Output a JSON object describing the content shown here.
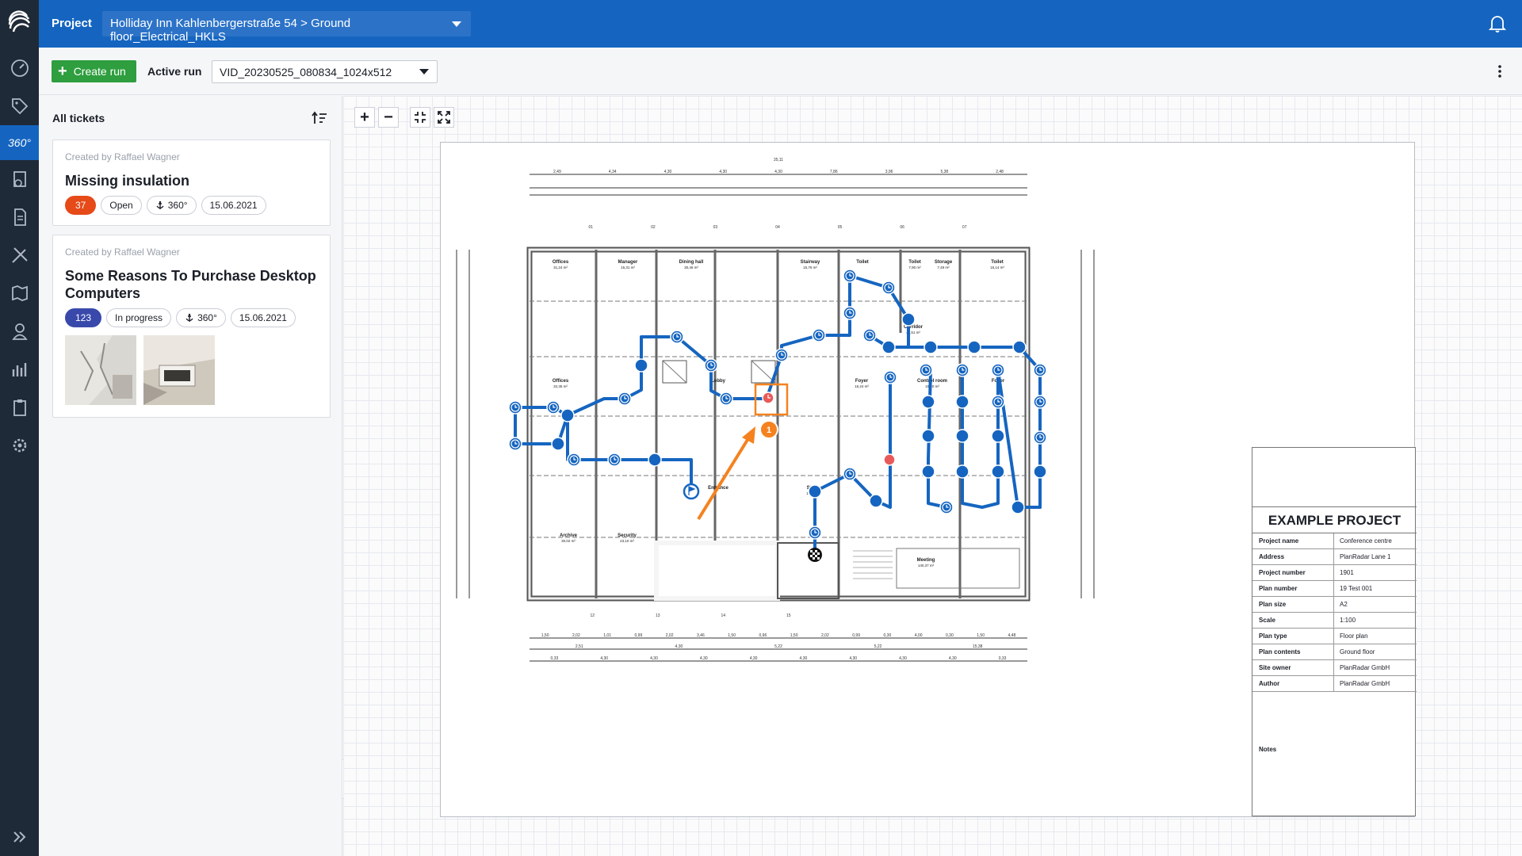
{
  "header": {
    "project_label": "Project",
    "project_path": "Holliday Inn Kahlenbergerstraße 54 > Ground floor_Electrical_HKLS"
  },
  "toolbar": {
    "create_run": "Create run",
    "active_run_label": "Active run",
    "active_run_value": "VID_20230525_080834_1024x512"
  },
  "nav": {
    "active_item": "360°"
  },
  "sidebar": {
    "heading": "All tickets",
    "tickets": [
      {
        "creator": "Created by Raffael Wagner",
        "title": "Missing insulation",
        "number": "37",
        "status": "Open",
        "type": "360°",
        "date": "15.06.2021"
      },
      {
        "creator": "Created by Raffael Wagner",
        "title": "Some Reasons To Purchase Desktop Computers",
        "number": "123",
        "status": "In progress",
        "type": "360°",
        "date": "15.06.2021"
      }
    ]
  },
  "plan": {
    "marker_number": "1",
    "rooms": [
      {
        "name": "Offices",
        "area": "31,24 m²"
      },
      {
        "name": "Manager",
        "area": "15,31 m²"
      },
      {
        "name": "Dining hall",
        "area": "30,46 m²"
      },
      {
        "name": "Stairway",
        "area": "15,76 m²"
      },
      {
        "name": "Toilet",
        "area": ""
      },
      {
        "name": "Toilet",
        "area": "7,90 m²"
      },
      {
        "name": "Storage",
        "area": "7,49 m²"
      },
      {
        "name": "Toilet",
        "area": "15,14 m²"
      },
      {
        "name": "Corridor",
        "area": "47,51 m²"
      },
      {
        "name": "Offices",
        "area": "32,35 m²"
      },
      {
        "name": "Lobby",
        "area": ""
      },
      {
        "name": "Foyer",
        "area": "16,24 m²"
      },
      {
        "name": "Control room",
        "area": "16,50 m²"
      },
      {
        "name": "Foyer",
        "area": ""
      },
      {
        "name": "Entrance",
        "area": ""
      },
      {
        "name": "Stairs",
        "area": "15,04 m²"
      },
      {
        "name": "Archive",
        "area": "30,02 m²"
      },
      {
        "name": "Security",
        "area": "23,10 m²"
      },
      {
        "name": "Meeting",
        "area": "140,37 m²"
      }
    ],
    "dims_top": [
      "2,49",
      "4,34",
      "4,30",
      "4,30",
      "4,30",
      "7,86",
      "3,96",
      "5,38",
      "2,48"
    ],
    "dims_top_total": "35,11",
    "dims_bottom": [
      "1,50",
      "2,02",
      "1,01",
      "0,99",
      "2,02",
      "3,46",
      "1,50",
      "0,96",
      "1,50",
      "2,02",
      "0,99",
      "0,30",
      "4,00",
      "0,30",
      "1,50",
      "4,48"
    ],
    "dims_bottom2": [
      "2,51",
      "4,30",
      "5,22",
      "5,22",
      "15,38"
    ],
    "dims_bottom3": [
      "0,33",
      "4,30",
      "4,30",
      "4,30",
      "4,30",
      "4,30",
      "4,30",
      "4,30",
      "4,30",
      "0,33"
    ],
    "axis_top": [
      "01",
      "02",
      "03",
      "04",
      "05",
      "06",
      "07"
    ],
    "axis_bottom": [
      "12",
      "13",
      "14",
      "15"
    ]
  },
  "title_block": {
    "heading": "EXAMPLE PROJECT",
    "rows": [
      {
        "key": "Project name",
        "value": "Conference centre"
      },
      {
        "key": "Address",
        "value": "PlanRadar Lane 1"
      },
      {
        "key": "Project number",
        "value": "1901"
      },
      {
        "key": "Plan number",
        "value": "19 Test 001"
      },
      {
        "key": "Plan size",
        "value": "A2"
      },
      {
        "key": "Scale",
        "value": "1:100"
      },
      {
        "key": "Plan type",
        "value": "Floor plan"
      },
      {
        "key": "Plan contents",
        "value": "Ground floor"
      },
      {
        "key": "Site owner",
        "value": "PlanRadar GmbH"
      },
      {
        "key": "Author",
        "value": "PlanRadar GmbH"
      }
    ],
    "notes_label": "Notes"
  },
  "colors": {
    "header": "#1565c0",
    "rail": "#1f2a38",
    "create": "#2e9e3f",
    "path": "#1565c0",
    "marker": "#f5821f",
    "pin": "#e85a5a"
  }
}
